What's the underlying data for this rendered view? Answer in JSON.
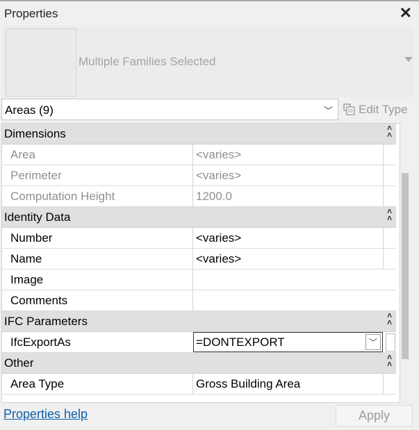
{
  "window": {
    "title": "Properties",
    "close_icon": "close-icon"
  },
  "type_selector": {
    "label": "Multiple Families Selected"
  },
  "category": {
    "value": "Areas (9)",
    "edit_type_label": "Edit Type"
  },
  "groups": [
    {
      "label": "Dimensions",
      "rows": [
        {
          "name": "Area",
          "value": "<varies>",
          "readonly": true
        },
        {
          "name": "Perimeter",
          "value": "<varies>",
          "readonly": true
        },
        {
          "name": "Computation Height",
          "value": "1200.0",
          "readonly": true
        }
      ]
    },
    {
      "label": "Identity Data",
      "rows": [
        {
          "name": "Number",
          "value": "<varies>",
          "readonly": false
        },
        {
          "name": "Name",
          "value": "<varies>",
          "readonly": false
        },
        {
          "name": "Image",
          "value": "",
          "readonly": false
        },
        {
          "name": "Comments",
          "value": "",
          "readonly": false
        }
      ]
    },
    {
      "label": "IFC Parameters",
      "rows": [
        {
          "name": "IfcExportAs",
          "value": "=DONTEXPORT",
          "readonly": false
        }
      ]
    },
    {
      "label": "Other",
      "rows": [
        {
          "name": "Area Type",
          "value": "Gross Building Area",
          "readonly": false
        }
      ]
    }
  ],
  "footer": {
    "help_link": "Properties help",
    "apply_label": "Apply"
  }
}
